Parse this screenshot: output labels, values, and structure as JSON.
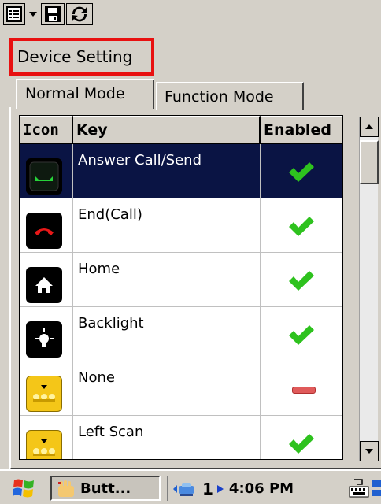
{
  "toolbar": {
    "menu_icon": "menu-list-icon",
    "dropdown_icon": "chevron-down-icon",
    "save_icon": "save-disk-icon",
    "refresh_icon": "refresh-icon"
  },
  "title": "Device Setting",
  "tabs": [
    {
      "label": "Normal Mode",
      "active": true
    },
    {
      "label": "Function Mode",
      "active": false
    }
  ],
  "grid": {
    "columns": [
      "Icon",
      "Key",
      "Enabled"
    ],
    "rows": [
      {
        "icon": "answer-call-icon",
        "key": "Answer Call/Send",
        "enabled": true,
        "selected": true
      },
      {
        "icon": "end-call-icon",
        "key": "End(Call)",
        "enabled": true,
        "selected": false
      },
      {
        "icon": "home-icon",
        "key": "Home",
        "enabled": true,
        "selected": false
      },
      {
        "icon": "backlight-icon",
        "key": "Backlight",
        "enabled": true,
        "selected": false
      },
      {
        "icon": "none-key-icon",
        "key": "None",
        "enabled": false,
        "selected": false
      },
      {
        "icon": "left-scan-icon",
        "key": "Left Scan",
        "enabled": true,
        "selected": false
      }
    ]
  },
  "taskbar": {
    "task_label": "Butt...",
    "tray_number": "1",
    "time": "4:06 PM"
  },
  "colors": {
    "selection": "#0a1444",
    "highlight_border": "#e81010",
    "check": "#2ec21e",
    "disabled": "#e05a5a"
  }
}
